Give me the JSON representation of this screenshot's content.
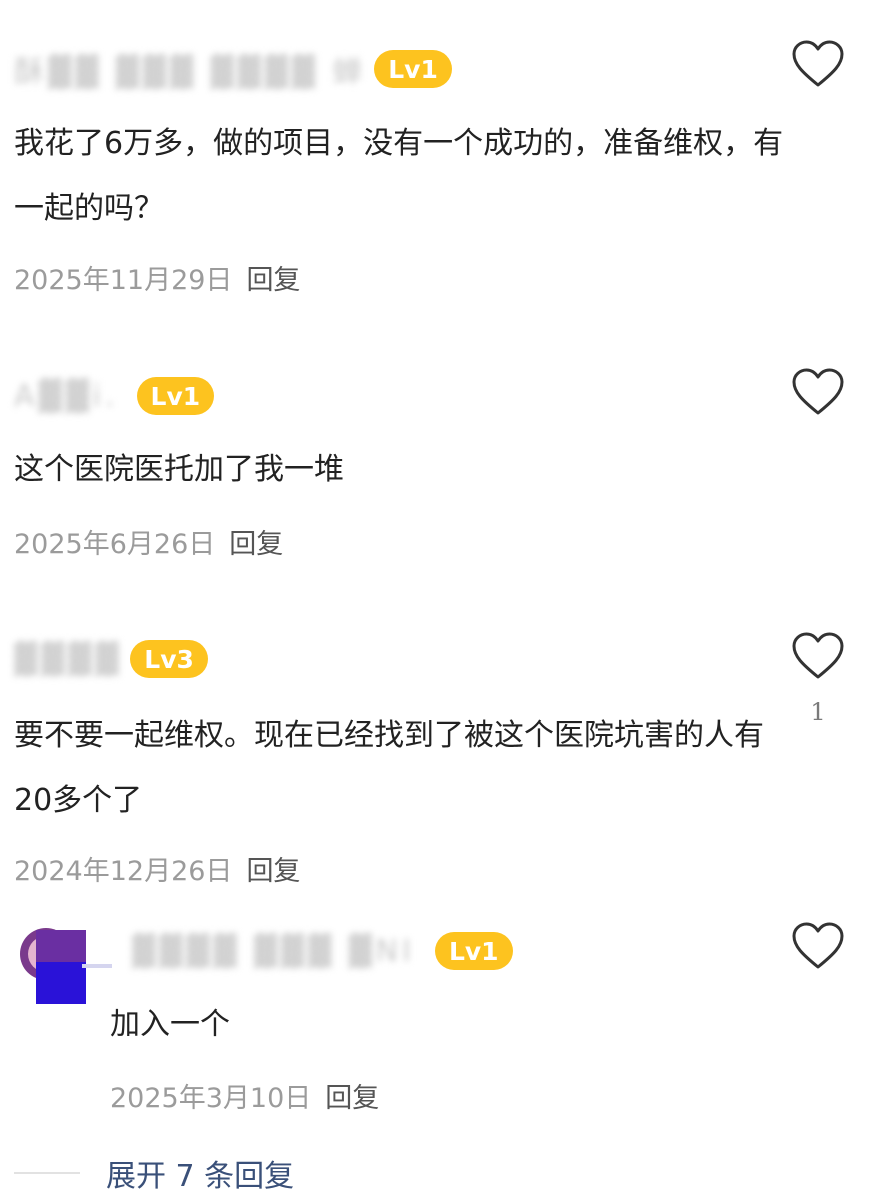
{
  "comments": [
    {
      "username": "酥▓▓ ▓▓▓ ▓▓▓▓ 蝉",
      "level": "Lv1",
      "text": "我花了6万多，做的项目，没有一个成功的，准备维权，有一起的吗？",
      "date": "2025年11月29日",
      "reply_label": "回复",
      "likes": ""
    },
    {
      "username": "A▓▓i.",
      "level": "Lv1",
      "text": "这个医院医托加了我一堆",
      "date": "2025年6月26日",
      "reply_label": "回复",
      "likes": ""
    },
    {
      "username": "▓▓▓▓",
      "level": "Lv3",
      "text": "要不要一起维权。现在已经找到了被这个医院坑害的人有20多个了",
      "date": "2024年12月26日",
      "reply_label": "回复",
      "likes": "1"
    },
    {
      "username": "▓▓▓▓ ▓▓▓ ▓NI",
      "level": "Lv1",
      "text": "加入一个",
      "date": "2025年3月10日",
      "reply_label": "回复",
      "likes": ""
    }
  ],
  "expand_replies": "展开 7 条回复",
  "colors": {
    "badge": "#fdc31f",
    "expand_link": "#3a5079",
    "meta_text": "#9b9b9b",
    "body_text": "#222222"
  },
  "icons": {
    "like": "heart-outline-icon",
    "avatar": "user-avatar"
  }
}
